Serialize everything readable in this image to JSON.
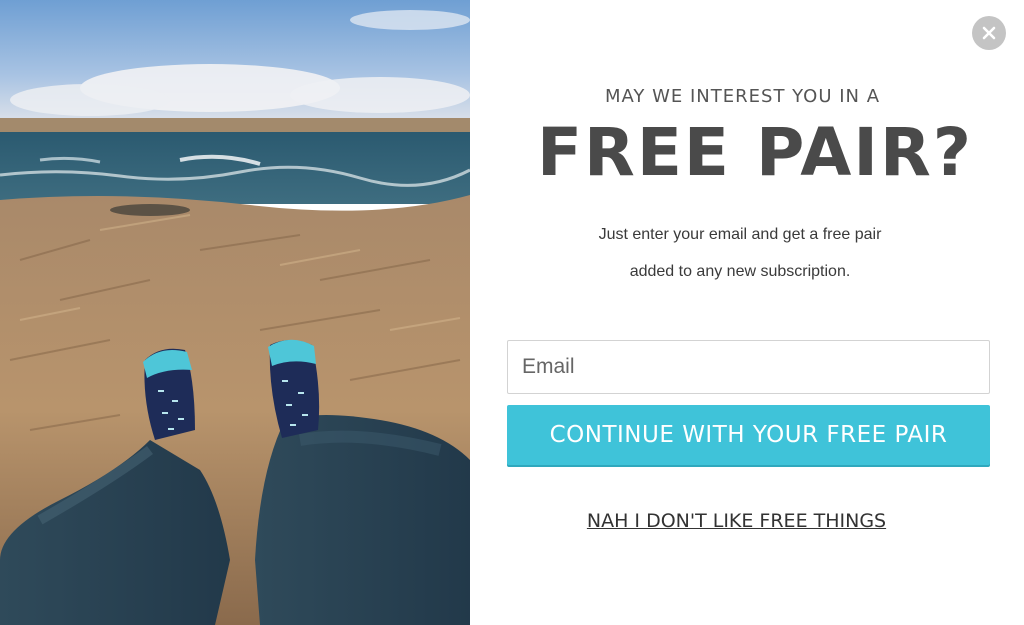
{
  "popup": {
    "kicker": "MAY WE INTEREST YOU IN A",
    "headline": "FREE PAIR?",
    "body_line_1": "Just enter your email and get  a free pair",
    "body_line_2": "added to any new subscription.",
    "email_placeholder": "Email",
    "email_value": "",
    "cta_label": "CONTINUE WITH YOUR FREE PAIR",
    "decline_label": "NAH I DON'T LIKE FREE THINGS",
    "close_icon": "close-icon"
  },
  "colors": {
    "accent": "#3fc3d9",
    "headline": "#4a4a4a",
    "close_bg": "#c4c4c4"
  }
}
